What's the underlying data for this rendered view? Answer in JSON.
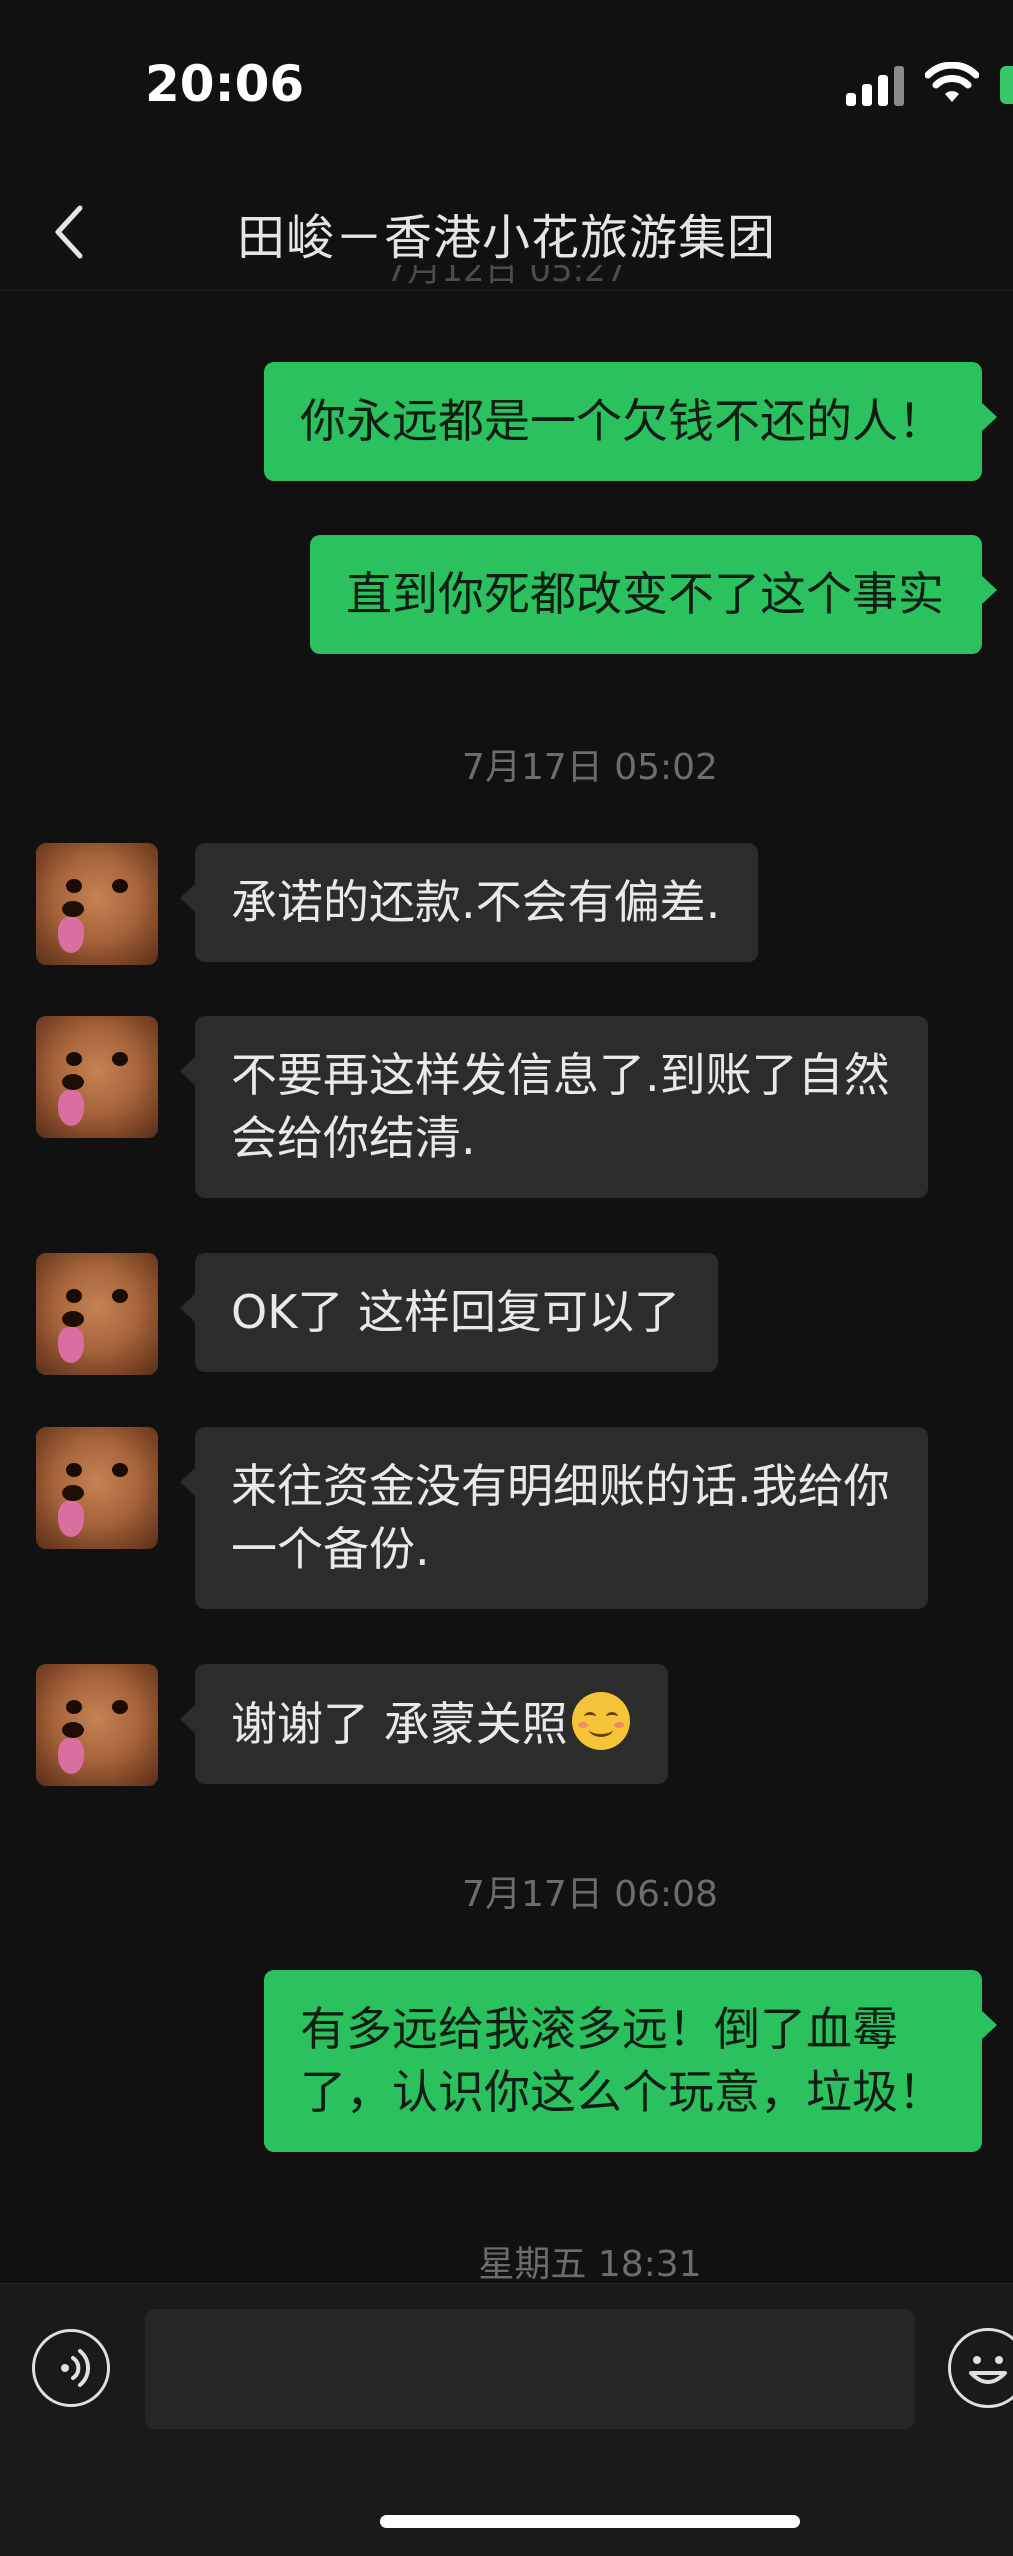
{
  "status_bar": {
    "time": "20:06"
  },
  "nav": {
    "title": "田峻－香港小花旅游集团"
  },
  "chat": {
    "partial_timestamp": "7月12日 05:27",
    "messages": [
      {
        "side": "out",
        "text": "你永远都是一个欠钱不还的人！"
      },
      {
        "side": "out",
        "text": "直到你死都改变不了这个事实"
      },
      {
        "timestamp": "7月17日 05:02"
      },
      {
        "side": "in",
        "text": "承诺的还款.不会有偏差."
      },
      {
        "side": "in",
        "lines": [
          "不要再这样发信息了.到账了自然",
          "会给你结清."
        ]
      },
      {
        "side": "in",
        "text": "OK了 这样回复可以了"
      },
      {
        "side": "in",
        "lines": [
          "来往资金没有明细账的话.我给你",
          "一个备份."
        ]
      },
      {
        "side": "in",
        "text": "谢谢了 承蒙关照",
        "emoji": "smiling-face-icon"
      },
      {
        "timestamp": "7月17日 06:08"
      },
      {
        "side": "out",
        "lines": [
          "有多远给我滚多远！倒了血霉",
          "了，认识你这么个玩意，垃圾！"
        ]
      },
      {
        "timestamp": "星期五 18:31"
      }
    ]
  },
  "input_bar": {
    "voice_icon": "voice-icon",
    "input_value": "",
    "emoji_icon": "emoji-icon"
  },
  "colors": {
    "background": "#111111",
    "outgoing_bubble": "#2bc15e",
    "incoming_bubble": "#2c2c2c"
  }
}
